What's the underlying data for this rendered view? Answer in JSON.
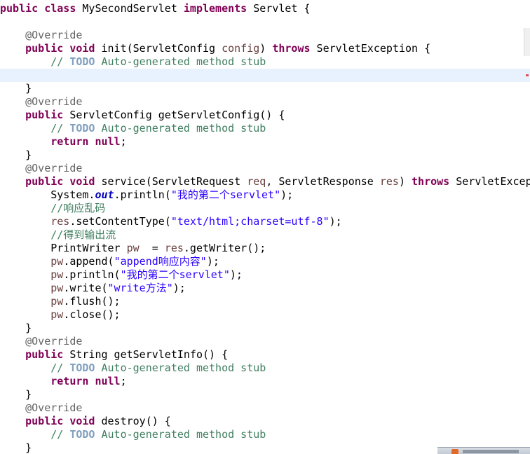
{
  "code": {
    "class_decl": {
      "kw1": "public",
      "kw2": "class",
      "name": "MySecondServlet",
      "kw3": "implements",
      "iface": "Servlet",
      "brace": "{"
    },
    "override": "@Override",
    "init_sig": {
      "kw1": "public",
      "kw2": "void",
      "rest": "init(ServletConfig ",
      "param": "config",
      "close": ") ",
      "kw3": "throws",
      "tail": " ServletException {"
    },
    "comment_prefix": "// ",
    "todo": "TODO",
    "comment_text": " Auto-generated method stub",
    "close_brace": "}",
    "getconfig_sig": {
      "kw1": "public",
      "rest": " ServletConfig getServletConfig() {"
    },
    "return_null": {
      "kw": "return",
      "kw2": "null",
      "semi": ";"
    },
    "service_sig": {
      "kw1": "public",
      "kw2": "void",
      "rest": " service(ServletRequest ",
      "p1": "req",
      "mid": ", ServletResponse ",
      "p2": "res",
      "close": ") ",
      "kw3": "throws",
      "tail": " ServletExcep"
    },
    "sysout": {
      "pre": "System.",
      "field": "out",
      "mid": ".println(",
      "str": "\"我的第二个servlet\"",
      "end": ");"
    },
    "cmt_encoding": "//响应乱码",
    "content_type": {
      "var": "res",
      "mid": ".setContentType(",
      "str": "\"text/html;charset=utf-8\"",
      "end": ");"
    },
    "cmt_output": "//得到输出流",
    "printwriter": {
      "pre": "PrintWriter ",
      "var": "pw",
      "mid": "  = ",
      "var2": "res",
      "end": ".getWriter();"
    },
    "pw_append": {
      "var": "pw",
      "mid": ".append(",
      "str": "\"append响应内容\"",
      "end": ");"
    },
    "pw_println": {
      "var": "pw",
      "mid": ".println(",
      "str": "\"我的第二个servlet\"",
      "end": ");"
    },
    "pw_write": {
      "var": "pw",
      "mid": ".write(",
      "str": "\"write方法\"",
      "end": ");"
    },
    "pw_flush": {
      "var": "pw",
      "end": ".flush();"
    },
    "pw_close": {
      "var": "pw",
      "end": ".close();"
    },
    "getinfo_sig": {
      "kw1": "public",
      "rest": " String getServletInfo() {"
    },
    "destroy_sig": {
      "kw1": "public",
      "kw2": "void",
      "rest": " destroy() {"
    }
  }
}
